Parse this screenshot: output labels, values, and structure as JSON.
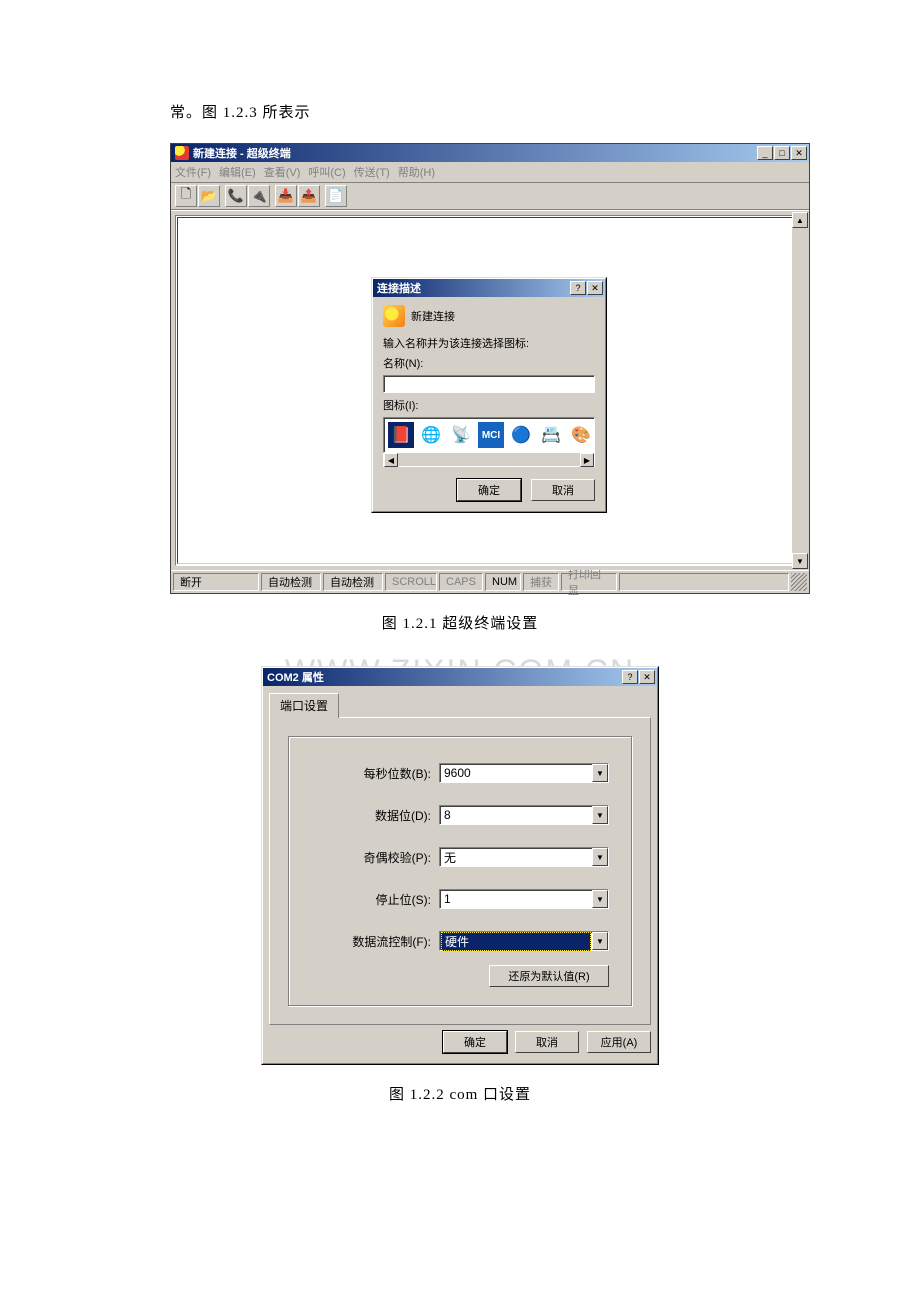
{
  "doc": {
    "intro_text": "常。图 1.2.3 所表示",
    "caption1": "图 1.2.1 超级终端设置",
    "caption2": "图 1.2.2 com 口设置",
    "watermark": "WWW.ZIXIN.COM.CN"
  },
  "ht_window": {
    "title": "新建连接 - 超级终端",
    "menu": {
      "file": "文件(F)",
      "edit": "编辑(E)",
      "view": "查看(V)",
      "call": "呼叫(C)",
      "transfer": "传送(T)",
      "help": "帮助(H)"
    },
    "toolbar_icons": {
      "new": "🗋",
      "open": "📂",
      "connect": "📞",
      "disconnect": "🔌",
      "send": "📥",
      "receive": "📤",
      "properties": "📄"
    },
    "scroll": {
      "up": "▲",
      "down": "▼",
      "left": "◀",
      "right": "▶"
    },
    "statusbar": {
      "state": "断开",
      "auto1": "自动检测",
      "auto2": "自动检测",
      "scroll": "SCROLL",
      "caps": "CAPS",
      "num": "NUM",
      "capture": "捕获",
      "echo": "打印回显"
    },
    "winbtns": {
      "min": "_",
      "max": "□",
      "close": "✕",
      "help": "?"
    }
  },
  "conn_dialog": {
    "title": "连接描述",
    "new_conn_label": "新建连接",
    "prompt": "输入名称并为该连接选择图标:",
    "name_label": "名称(N):",
    "name_value": "",
    "icon_label": "图标(I):",
    "icons": [
      "📕",
      "🌐",
      "📡",
      "MCI",
      "🔵",
      "📇",
      "🎨"
    ],
    "ok": "确定",
    "cancel": "取消"
  },
  "com_dialog": {
    "title": "COM2 属性",
    "tab": "端口设置",
    "fields": {
      "bps": {
        "label": "每秒位数(B):",
        "value": "9600"
      },
      "data": {
        "label": "数据位(D):",
        "value": "8"
      },
      "parity": {
        "label": "奇偶校验(P):",
        "value": "无"
      },
      "stop": {
        "label": "停止位(S):",
        "value": "1"
      },
      "flow": {
        "label": "数据流控制(F):",
        "value": "硬件"
      }
    },
    "restore": "还原为默认值(R)",
    "ok": "确定",
    "cancel": "取消",
    "apply": "应用(A)"
  }
}
